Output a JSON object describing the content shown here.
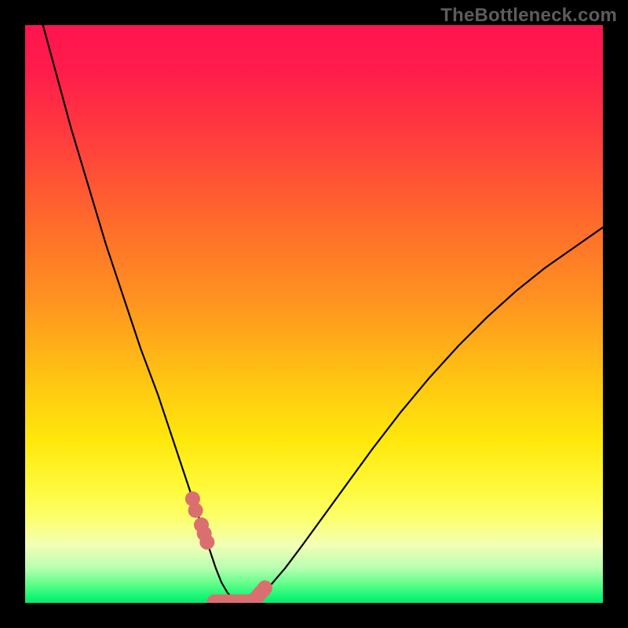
{
  "watermark": "TheBottleneck.com",
  "colors": {
    "marker": "#db6e6f",
    "curve": "#000000"
  },
  "chart_data": {
    "type": "line",
    "title": "",
    "xlabel": "",
    "ylabel": "",
    "xlim": [
      0,
      100
    ],
    "ylim": [
      0,
      100
    ],
    "x": [
      0,
      2,
      5,
      8,
      11,
      14,
      17,
      20,
      23,
      25,
      27,
      29,
      30.5,
      32,
      33,
      34,
      35,
      36,
      37,
      38.5,
      40,
      42,
      45,
      48,
      52,
      56,
      60,
      65,
      70,
      75,
      80,
      85,
      90,
      95,
      100
    ],
    "values": [
      112,
      104,
      93,
      82,
      72,
      62,
      53,
      44,
      36,
      30,
      24,
      18,
      13.5,
      9,
      6,
      3.5,
      1.8,
      0.6,
      0,
      0,
      0.8,
      2.5,
      6,
      10,
      15.5,
      21,
      26.5,
      33,
      39,
      44.5,
      49.5,
      54,
      58,
      61.5,
      65
    ],
    "minimum_region_x": [
      35.5,
      40.5
    ],
    "markers": {
      "left_cluster_x": [
        29.0,
        29.5,
        30.5,
        31.0,
        31.5
      ],
      "right_cluster_x": [
        38.7,
        39.8,
        40.3,
        40.8,
        41.3,
        41.5
      ],
      "approx_y_by_x": {
        "29.0": 18.0,
        "29.5": 16.0,
        "30.5": 13.5,
        "31.0": 12.0,
        "31.5": 10.5,
        "38.7": 0.2,
        "39.8": 0.6,
        "40.3": 1.2,
        "40.8": 1.8,
        "41.3": 2.3,
        "41.5": 2.6
      },
      "pill": {
        "x_start": 32.8,
        "x_end": 38.0,
        "y": 0.1
      }
    }
  }
}
